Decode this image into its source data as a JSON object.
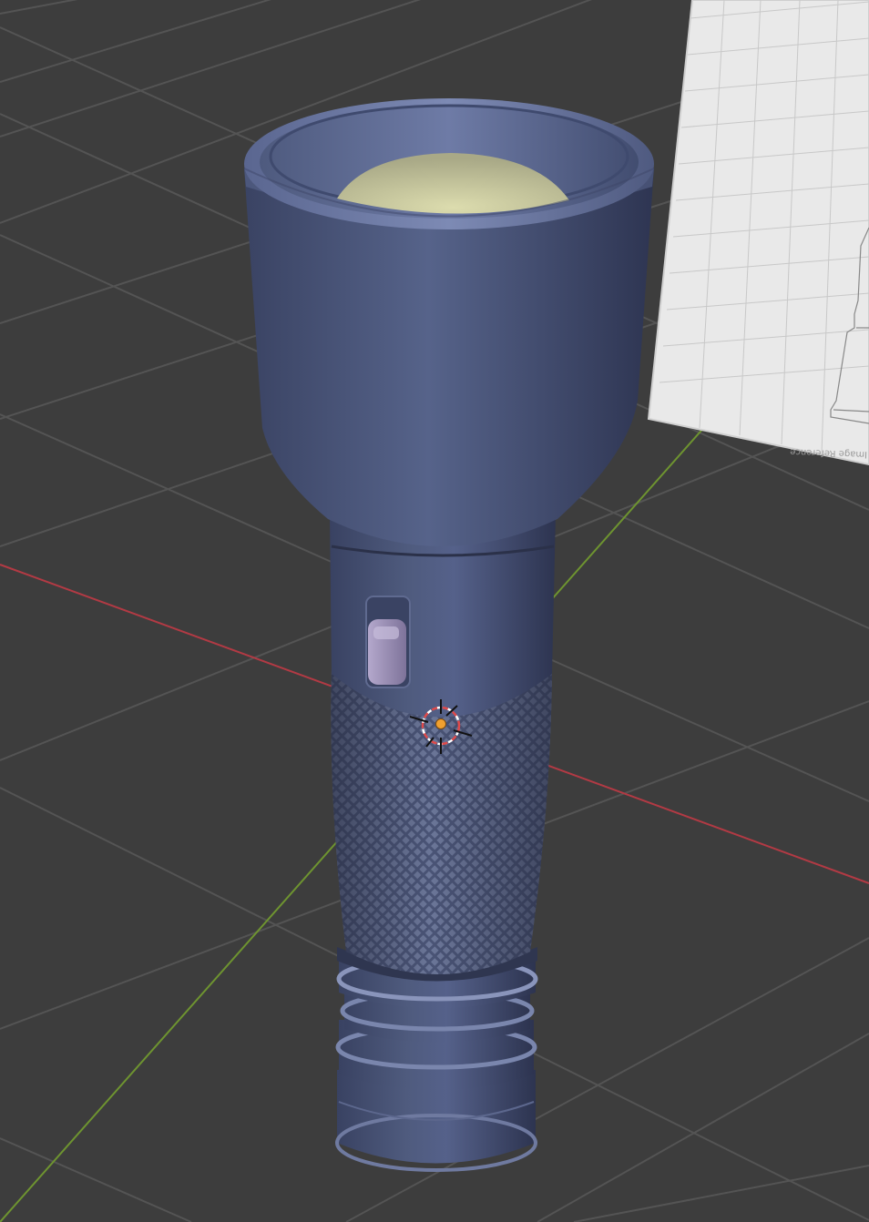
{
  "viewport": {
    "background": "#3d3d3d",
    "grid_line_color": "#545454",
    "x_axis_color": "#b23a44",
    "y_axis_color": "#6e9430"
  },
  "reference_image": {
    "caption": "Image Reference",
    "background": "#e9e9e9"
  },
  "model": {
    "body_color": "#4b5677",
    "lens_color": "#cfcf9c",
    "switch_color": "#9b8eb4",
    "knurl_color": "#6a7597"
  },
  "cursor_3d": {
    "ring_color": "#e04a4a",
    "center_color": "#f0a030"
  }
}
